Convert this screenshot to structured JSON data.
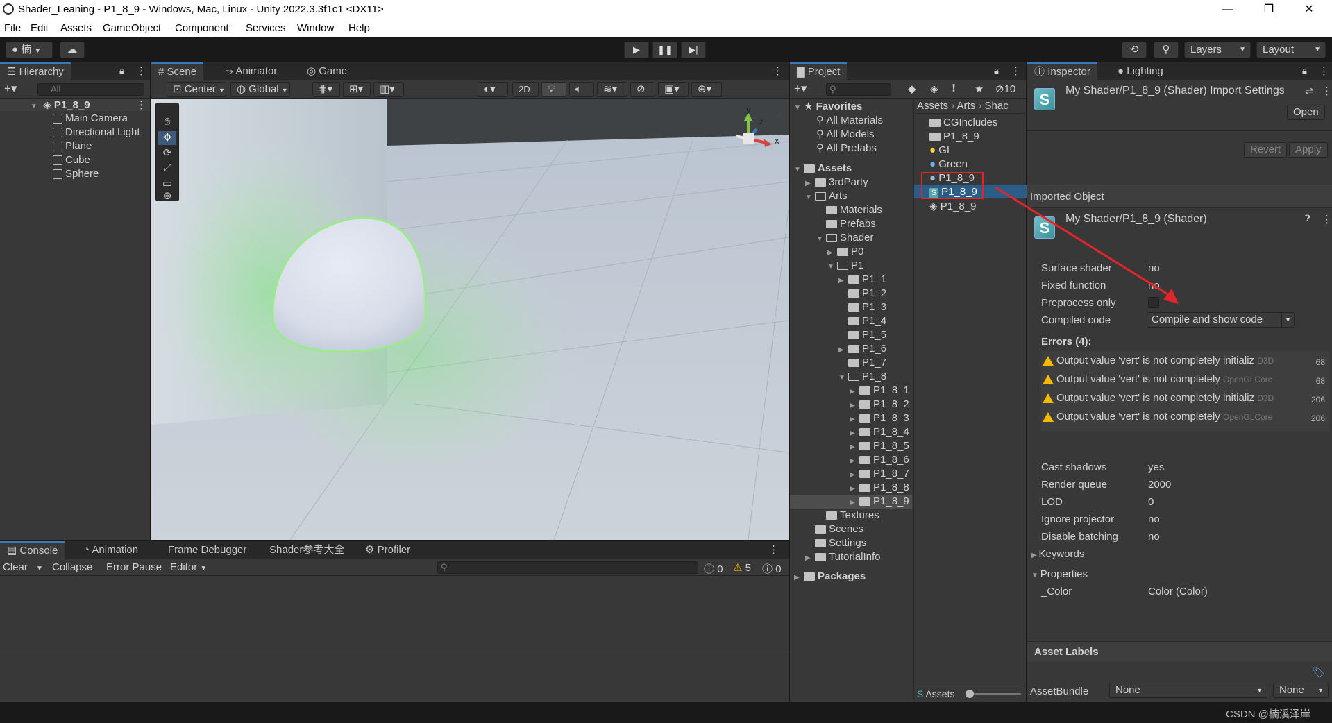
{
  "window": {
    "title": "Shader_Leaning - P1_8_9 - Windows, Mac, Linux - Unity 2022.3.3f1c1 <DX11>",
    "minimize": "—",
    "restore": "❐",
    "close": "✕"
  },
  "menu": [
    "File",
    "Edit",
    "Assets",
    "GameObject",
    "Component",
    "Services",
    "Window",
    "Help"
  ],
  "toolbar": {
    "account": "楠",
    "layers": "Layers",
    "layout": "Layout"
  },
  "hierarchy": {
    "tab": "Hierarchy",
    "search_placeholder": "All",
    "scene": "P1_8_9",
    "items": [
      "Main Camera",
      "Directional Light",
      "Plane",
      "Cube",
      "Sphere"
    ]
  },
  "scene_tabs": [
    "Scene",
    "Animator",
    "Game"
  ],
  "scene_toolbar": {
    "pivot": "Center",
    "space": "Global",
    "mode_2d": "2D"
  },
  "gizmo": {
    "y": "y",
    "x": "x",
    "z": "z"
  },
  "project": {
    "tab": "Project",
    "hidden_count": "10",
    "favorites_label": "Favorites",
    "favorites": [
      "All Materials",
      "All Models",
      "All Prefabs"
    ],
    "assets_label": "Assets",
    "tree": [
      {
        "label": "3rdParty",
        "depth": 1
      },
      {
        "label": "Arts",
        "depth": 1
      },
      {
        "label": "Materials",
        "depth": 2
      },
      {
        "label": "Prefabs",
        "depth": 2
      },
      {
        "label": "Shader",
        "depth": 2
      },
      {
        "label": "P0",
        "depth": 3
      },
      {
        "label": "P1",
        "depth": 3
      },
      {
        "label": "P1_1",
        "depth": 4
      },
      {
        "label": "P1_2",
        "depth": 4
      },
      {
        "label": "P1_3",
        "depth": 4
      },
      {
        "label": "P1_4",
        "depth": 4
      },
      {
        "label": "P1_5",
        "depth": 4
      },
      {
        "label": "P1_6",
        "depth": 4
      },
      {
        "label": "P1_7",
        "depth": 4
      },
      {
        "label": "P1_8",
        "depth": 4
      },
      {
        "label": "P1_8_1",
        "depth": 5
      },
      {
        "label": "P1_8_2",
        "depth": 5
      },
      {
        "label": "P1_8_3",
        "depth": 5
      },
      {
        "label": "P1_8_4",
        "depth": 5
      },
      {
        "label": "P1_8_5",
        "depth": 5
      },
      {
        "label": "P1_8_6",
        "depth": 5
      },
      {
        "label": "P1_8_7",
        "depth": 5
      },
      {
        "label": "P1_8_8",
        "depth": 5
      },
      {
        "label": "P1_8_9",
        "depth": 5
      },
      {
        "label": "Textures",
        "depth": 2
      },
      {
        "label": "Scenes",
        "depth": 1
      },
      {
        "label": "Settings",
        "depth": 1
      },
      {
        "label": "TutorialInfo",
        "depth": 1
      }
    ],
    "packages_label": "Packages",
    "breadcrumb": [
      "Assets",
      "Arts",
      "Shac"
    ],
    "files": [
      "CGIncludes",
      "P1_8_9",
      "GI",
      "Green",
      "P1_8_9",
      "P1_8_9",
      "P1_8_9"
    ],
    "footer": "Assets"
  },
  "inspector": {
    "tabs": [
      "Inspector",
      "Lighting"
    ],
    "header_title": "My Shader/P1_8_9 (Shader) Import Settings",
    "open": "Open",
    "revert": "Revert",
    "apply": "Apply",
    "imported_object": "Imported Object",
    "object_title": "My Shader/P1_8_9 (Shader)",
    "fields": [
      {
        "label": "Surface shader",
        "value": "no"
      },
      {
        "label": "Fixed function",
        "value": "no"
      },
      {
        "label": "Preprocess only",
        "value": ""
      },
      {
        "label": "Compiled code",
        "value": "Compile and show code"
      }
    ],
    "errors_title": "Errors (4):",
    "errors": [
      {
        "msg": "Output value 'vert' is not completely initializ",
        "api": "D3D",
        "line": "68"
      },
      {
        "msg": "Output value 'vert' is not completely",
        "api": "OpenGLCore",
        "line": "68"
      },
      {
        "msg": "Output value 'vert' is not completely initializ",
        "api": "D3D",
        "line": "206"
      },
      {
        "msg": "Output value 'vert' is not completely",
        "api": "OpenGLCore",
        "line": "206"
      }
    ],
    "props": [
      {
        "label": "Cast shadows",
        "value": "yes"
      },
      {
        "label": "Render queue",
        "value": "2000"
      },
      {
        "label": "LOD",
        "value": "0"
      },
      {
        "label": "Ignore projector",
        "value": "no"
      },
      {
        "label": "Disable batching",
        "value": "no"
      }
    ],
    "keywords": "Keywords",
    "properties": "Properties",
    "color_prop": {
      "label": "_Color",
      "value": "Color (Color)"
    },
    "asset_labels": "Asset Labels",
    "assetbundle_label": "AssetBundle",
    "assetbundle_value": "None",
    "variant_value": "None"
  },
  "console": {
    "tabs": [
      "Console",
      "Animation",
      "Frame Debugger",
      "Shader参考大全",
      "Profiler"
    ],
    "clear": "Clear",
    "collapse": "Collapse",
    "error_pause": "Error Pause",
    "editor": "Editor",
    "log_count": "0",
    "warn_count": "5",
    "error_count": "0"
  },
  "watermark": "CSDN @楠溪泽岸",
  "colors": {
    "accent": "#3a79bb",
    "highlight_box": "#e0262a",
    "warning": "#f5b900",
    "selection": "#2c5d87"
  }
}
